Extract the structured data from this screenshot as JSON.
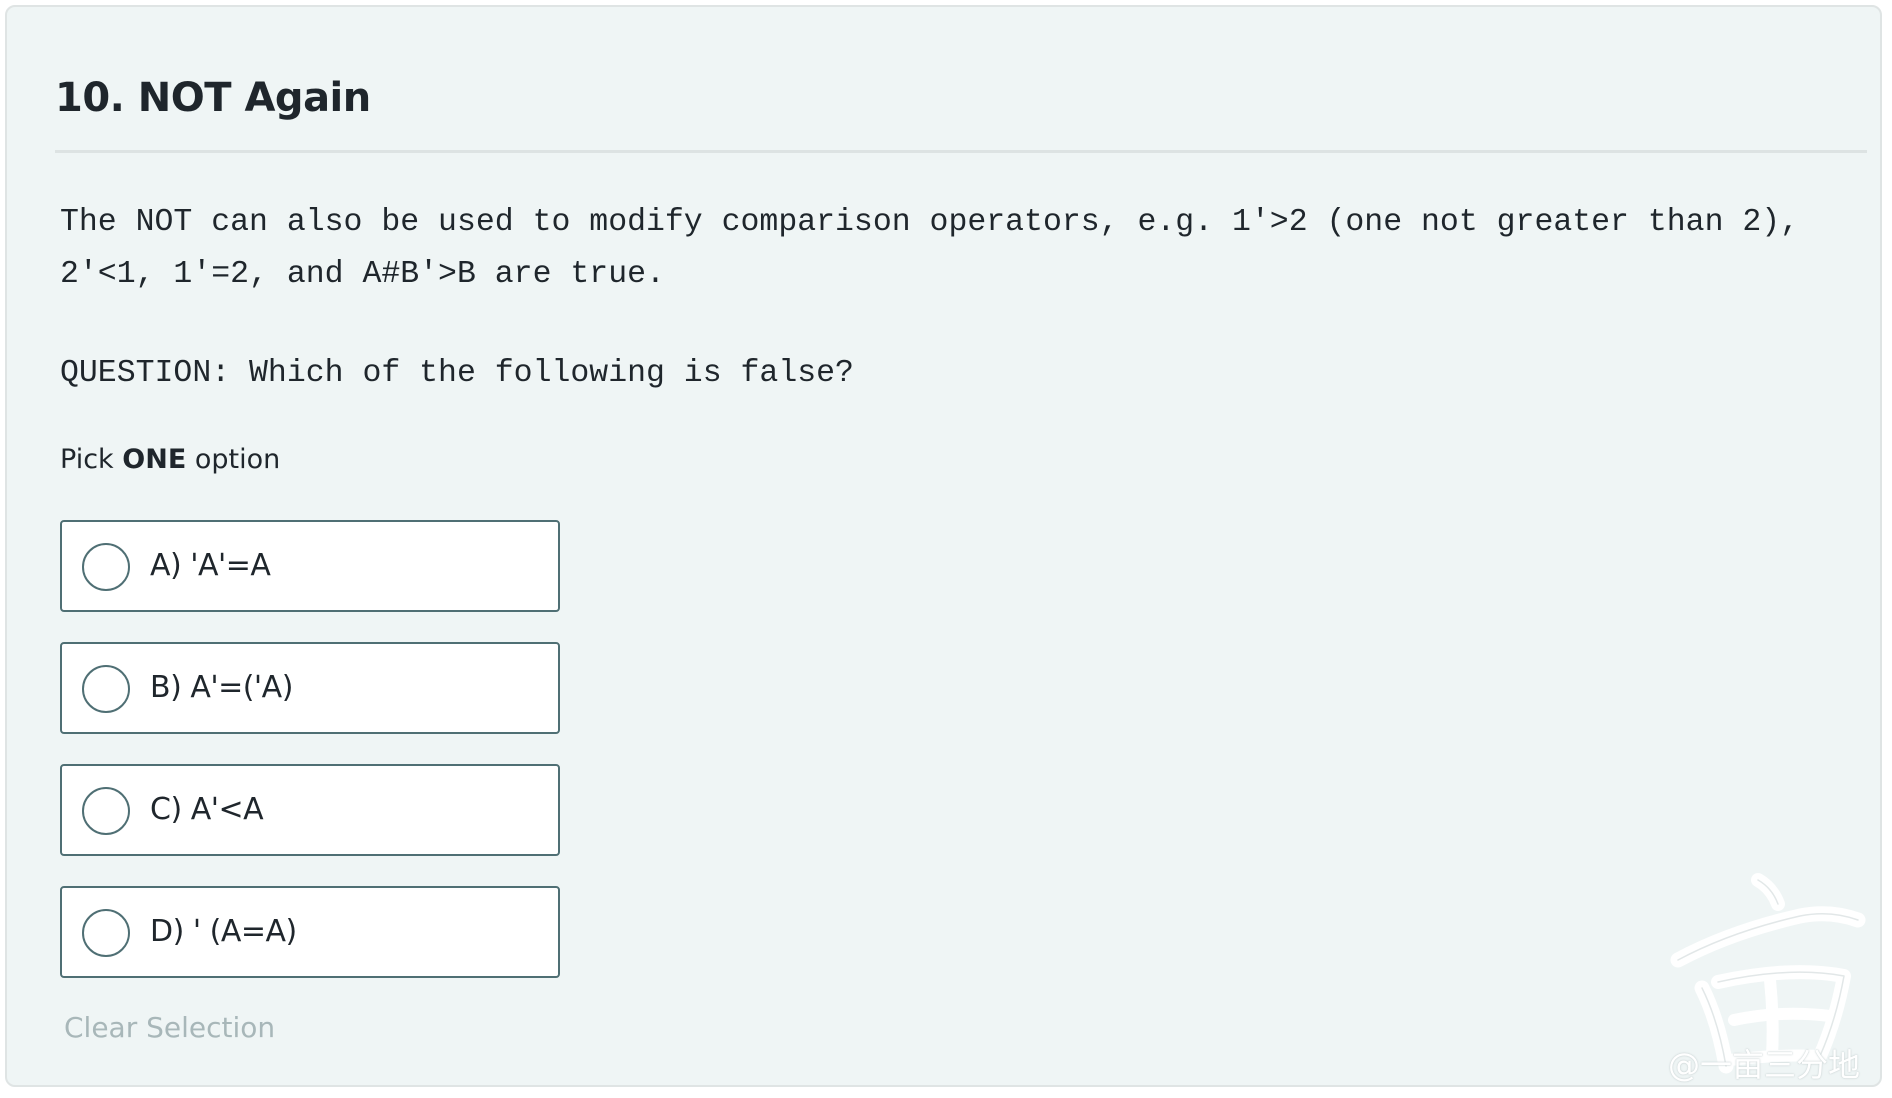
{
  "question": {
    "title": "10. NOT Again",
    "statement_line1": "The NOT can also be used to modify comparison operators, e.g. 1'>2 (one not greater than 2),",
    "statement_line2": "2'<1, 1'=2, and A#B'>B are true.",
    "prompt": "QUESTION: Which of the following is false?"
  },
  "instructions": {
    "prefix": "Pick ",
    "emphasis": "ONE",
    "suffix": " option"
  },
  "options": [
    {
      "label": "A) 'A'=A",
      "selected": false
    },
    {
      "label": "B) A'=('A)",
      "selected": false
    },
    {
      "label": "C) A'<A",
      "selected": false
    },
    {
      "label": "D) ' (A=A)",
      "selected": false
    }
  ],
  "clear_label": "Clear Selection",
  "watermark": {
    "text": "@一亩三分地"
  },
  "colors": {
    "background": "#eff5f5",
    "text": "#1f262c",
    "option_border": "#4f6f74",
    "muted": "#a8b7b9"
  }
}
